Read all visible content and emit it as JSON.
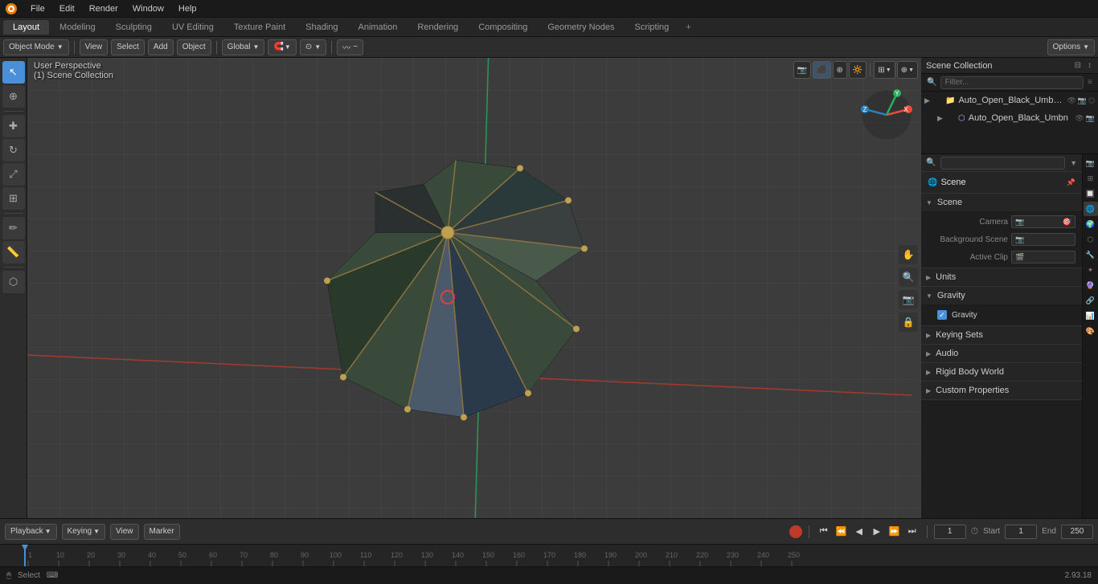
{
  "app": {
    "title": "Blender",
    "version": "2.93.18"
  },
  "top_menu": {
    "items": [
      "File",
      "Edit",
      "Render",
      "Window",
      "Help"
    ]
  },
  "workspace_tabs": {
    "tabs": [
      "Layout",
      "Modeling",
      "Sculpting",
      "UV Editing",
      "Texture Paint",
      "Shading",
      "Animation",
      "Rendering",
      "Compositing",
      "Geometry Nodes",
      "Scripting"
    ],
    "active": "Layout",
    "add_label": "+"
  },
  "viewport": {
    "mode": "Object Mode",
    "view_label": "View",
    "select_label": "Select",
    "add_label": "Add",
    "object_label": "Object",
    "perspective_label": "User Perspective",
    "collection_label": "(1) Scene Collection",
    "global_label": "Global",
    "options_label": "Options"
  },
  "overlay_buttons": {
    "camera_icon": "📷",
    "render_icon": "🔲",
    "overlay_icon": "⊞",
    "gizmo_icon": "⊕"
  },
  "gizmo": {
    "x_label": "X",
    "y_label": "Y",
    "z_label": "Z"
  },
  "outliner": {
    "title": "Scene Collection",
    "search_placeholder": "Filter...",
    "items": [
      {
        "name": "Auto_Open_Black_Umbrella_f",
        "indent": 1,
        "type": "collection",
        "icons": [
          "eye",
          "camera",
          "render"
        ]
      },
      {
        "name": "Auto_Open_Black_Umbn",
        "indent": 2,
        "type": "mesh",
        "icons": [
          "eye",
          "camera"
        ]
      }
    ]
  },
  "properties": {
    "panel_title": "Scene",
    "scene_section": {
      "title": "Scene",
      "camera_label": "Camera",
      "camera_value": "",
      "background_scene_label": "Background Scene",
      "active_clip_label": "Active Clip"
    },
    "sections": [
      {
        "title": "Units",
        "collapsed": true
      },
      {
        "title": "Gravity",
        "collapsed": false,
        "has_checkbox": true,
        "checkbox_checked": true
      },
      {
        "title": "Keying Sets",
        "collapsed": true
      },
      {
        "title": "Audio",
        "collapsed": true
      },
      {
        "title": "Rigid Body World",
        "collapsed": true
      },
      {
        "title": "Custom Properties",
        "collapsed": true
      }
    ]
  },
  "timeline": {
    "playback_label": "Playback",
    "keying_label": "Keying",
    "view_label": "View",
    "marker_label": "Marker",
    "current_frame": "1",
    "start_label": "Start",
    "start_frame": "1",
    "end_label": "End",
    "end_frame": "250",
    "frame_numbers": [
      "",
      "10",
      "20",
      "30",
      "40",
      "50",
      "60",
      "70",
      "80",
      "90",
      "100",
      "110",
      "120",
      "130",
      "140",
      "150",
      "160",
      "170",
      "180",
      "190",
      "200",
      "210",
      "220",
      "230",
      "240",
      "250"
    ]
  },
  "status_bar": {
    "select_label": "Select",
    "version": "2.93.18"
  },
  "props_tab_icons": [
    {
      "icon": "🔧",
      "title": "Tool"
    },
    {
      "icon": "⊞",
      "title": "View Layer"
    },
    {
      "icon": "🌐",
      "title": "Scene"
    },
    {
      "icon": "🌍",
      "title": "World"
    },
    {
      "icon": "📷",
      "title": "Object"
    },
    {
      "icon": "⬡",
      "title": "Modifier"
    },
    {
      "icon": "⬡",
      "title": "Particles"
    },
    {
      "icon": "🔮",
      "title": "Physics"
    },
    {
      "icon": "📊",
      "title": "Constraints"
    },
    {
      "icon": "🔲",
      "title": "Data"
    },
    {
      "icon": "🎨",
      "title": "Material"
    },
    {
      "icon": "🖼",
      "title": "Render"
    }
  ]
}
